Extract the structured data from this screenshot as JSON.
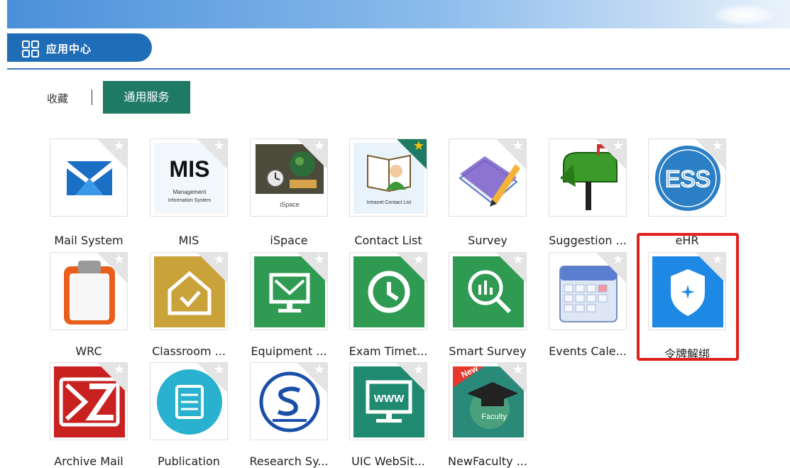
{
  "header": {
    "title": "应用中心",
    "title_icon": "grid-icon"
  },
  "tabs": [
    {
      "label": "收藏",
      "active": false
    },
    {
      "label": "通用服务",
      "active": true
    }
  ],
  "apps": [
    {
      "name": "Mail System",
      "icon": "mail-icon",
      "favorite": false
    },
    {
      "name": "MIS",
      "icon": "mis-logo-icon",
      "favorite": false,
      "icon_title": "MIS",
      "icon_subtitle1": "Management",
      "icon_subtitle2": "Information System"
    },
    {
      "name": "iSpace",
      "icon": "ispace-icon",
      "favorite": false,
      "icon_caption": "iSpace"
    },
    {
      "name": "Contact List",
      "icon": "contact-list-icon",
      "favorite": true,
      "icon_caption": "Intranet Contact List"
    },
    {
      "name": "Survey",
      "icon": "survey-icon",
      "favorite": false
    },
    {
      "name": "Suggestion ...",
      "icon": "mailbox-icon",
      "favorite": false
    },
    {
      "name": "eHR",
      "icon": "ess-icon",
      "favorite": false,
      "icon_caption": "ESS"
    },
    {
      "name": "WRC",
      "icon": "clipboard-icon",
      "favorite": false
    },
    {
      "name": "Classroom ...",
      "icon": "classroom-icon",
      "favorite": false
    },
    {
      "name": "Equipment ...",
      "icon": "equipment-icon",
      "favorite": false
    },
    {
      "name": "Exam Timet...",
      "icon": "clock-icon",
      "favorite": false
    },
    {
      "name": "Smart Survey",
      "icon": "chart-search-icon",
      "favorite": false
    },
    {
      "name": "Events Cale...",
      "icon": "calendar-icon",
      "favorite": false
    },
    {
      "name": "令牌解绑",
      "icon": "shield-icon",
      "favorite": false,
      "highlighted": true
    },
    {
      "name": "Archive Mail",
      "icon": "archive-mail-icon",
      "favorite": false
    },
    {
      "name": "Publication",
      "icon": "book-icon",
      "favorite": false
    },
    {
      "name": "Research Sy...",
      "icon": "research-icon",
      "favorite": false
    },
    {
      "name": "UIC WebSit...",
      "icon": "website-icon",
      "favorite": false,
      "icon_caption": "WWW"
    },
    {
      "name": "NewFaculty ...",
      "icon": "new-faculty-icon",
      "favorite": false,
      "icon_badge": "New",
      "icon_caption": "Faculty"
    }
  ],
  "colors": {
    "primary": "#1f6db7",
    "tab_active": "#1f7a64",
    "highlight": "#e0201b"
  }
}
